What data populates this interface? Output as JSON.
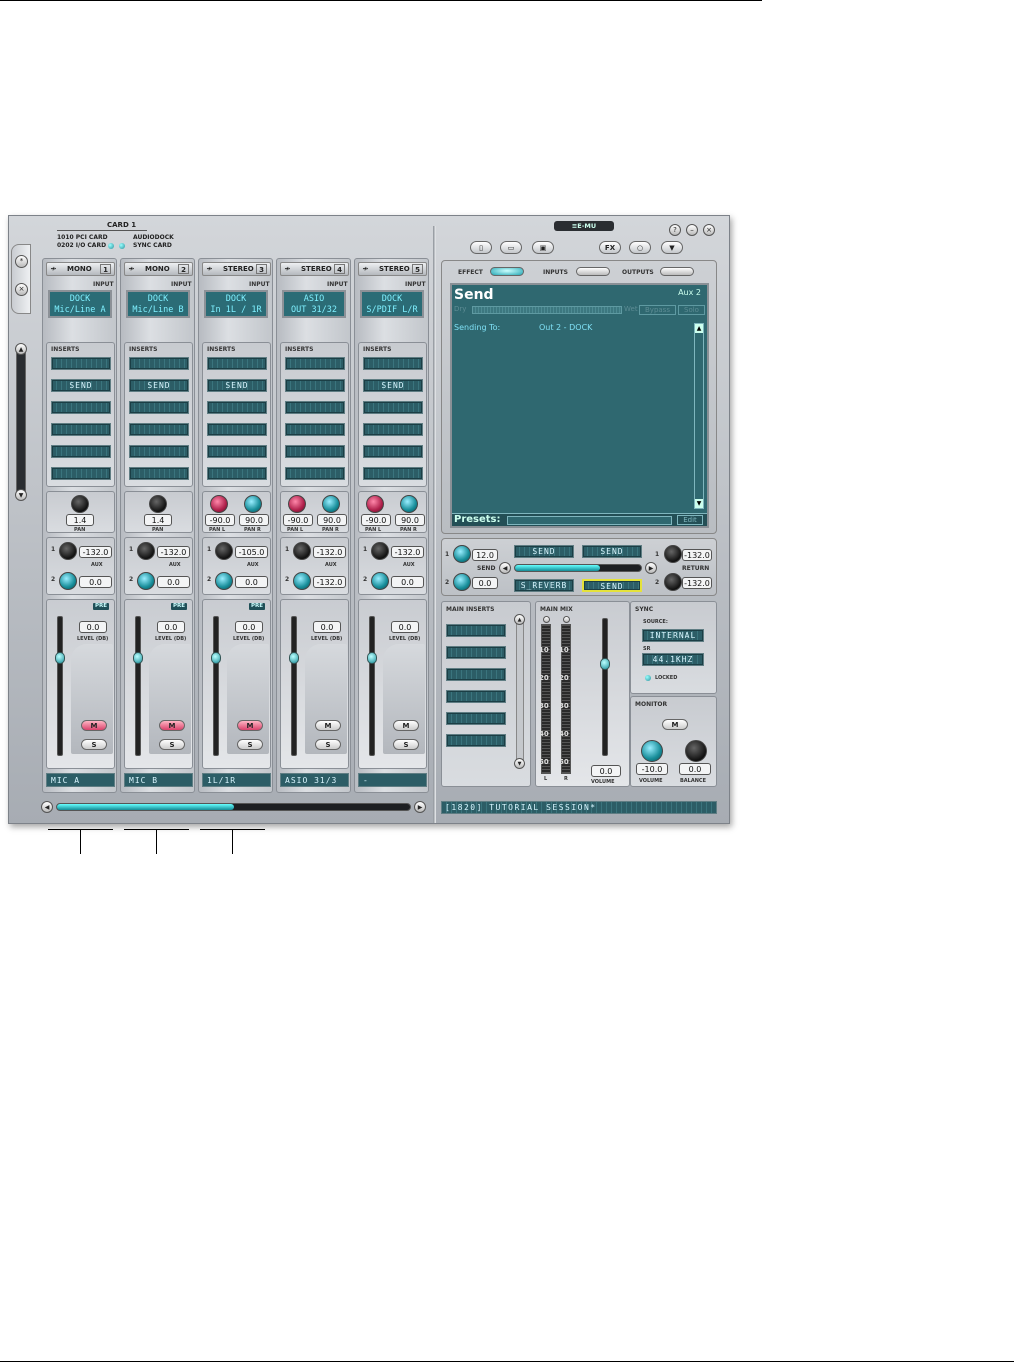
{
  "header": {
    "card_title": "CARD 1",
    "card_1010": "1010 PCI CARD",
    "card_0202": "0202 I/O CARD",
    "audiodock": "AUDIODOCK",
    "sync_card": "SYNC CARD",
    "brand": "≡E-MU"
  },
  "strips": [
    {
      "type": "MONO",
      "num": "1",
      "input1": "DOCK",
      "input2": "Mic/Line A",
      "send": "SEND",
      "pan": [
        "1.4"
      ],
      "pan_labels": [
        "PAN"
      ],
      "aux1": "-132.0",
      "aux2": "0.0",
      "level": "0.0",
      "name": "MIC A",
      "muted": true
    },
    {
      "type": "MONO",
      "num": "2",
      "input1": "DOCK",
      "input2": "Mic/Line B",
      "send": "SEND",
      "pan": [
        "1.4"
      ],
      "pan_labels": [
        "PAN"
      ],
      "aux1": "-132.0",
      "aux2": "0.0",
      "level": "0.0",
      "name": "MIC B",
      "muted": true
    },
    {
      "type": "STEREO",
      "num": "3",
      "input1": "DOCK",
      "input2": "In 1L / 1R",
      "send": "SEND",
      "pan": [
        "-90.0",
        "90.0"
      ],
      "pan_labels": [
        "PAN L",
        "PAN R"
      ],
      "aux1": "-105.0",
      "aux2": "0.0",
      "level": "0.0",
      "name": "1L/1R",
      "muted": true
    },
    {
      "type": "STEREO",
      "num": "4",
      "input1": "ASIO",
      "input2": "OUT 31/32",
      "send": "",
      "pan": [
        "-90.0",
        "90.0"
      ],
      "pan_labels": [
        "PAN L",
        "PAN R"
      ],
      "aux1": "-132.0",
      "aux2": "-132.0",
      "level": "0.0",
      "name": "ASIO 31/3",
      "muted": false
    },
    {
      "type": "STEREO",
      "num": "5",
      "input1": "DOCK",
      "input2": "S/PDIF L/R",
      "send": "SEND",
      "pan": [
        "-90.0",
        "90.0"
      ],
      "pan_labels": [
        "PAN L",
        "PAN R"
      ],
      "aux1": "-132.0",
      "aux2": "0.0",
      "level": "0.0",
      "name": "-",
      "muted": false
    }
  ],
  "labels": {
    "input": "INPUT",
    "inserts": "INSERTS",
    "aux": "AUX",
    "level": "LEVEL (DB)",
    "pre": "PRE",
    "mute": "M",
    "solo": "S"
  },
  "tabs": {
    "effect": "EFFECT",
    "inputs": "INPUTS",
    "outputs": "OUTPUTS"
  },
  "toolbar": {
    "fx": "FX"
  },
  "effect_screen": {
    "title": "Send",
    "aux": "Aux 2",
    "dry": "Dry",
    "wet": "Wet",
    "bypass": "Bypass",
    "solo": "Solo",
    "sending_to_label": "Sending To:",
    "sending_to_value": "Out 2 - DOCK",
    "presets": "Presets:",
    "edit": "Edit"
  },
  "aux_section": {
    "send1": "12.0",
    "send2": "0.0",
    "send_label": "SEND",
    "return_label": "RETURN",
    "return1": "-132.0",
    "return2": "-132.0",
    "slot1": "SEND",
    "slot2": "SEND",
    "slot3": "S_REVERB",
    "slot4": "SEND"
  },
  "main_inserts": {
    "title": "MAIN INSERTS"
  },
  "main_mix": {
    "title": "MAIN MIX",
    "scale": [
      "10",
      "20",
      "30",
      "40",
      "50"
    ],
    "volume": "0.0",
    "volume_label": "VOLUME",
    "l": "L",
    "r": "R"
  },
  "sync": {
    "title": "SYNC",
    "source_label": "SOURCE:",
    "source": "INTERNAL",
    "sr_label": "SR",
    "sr": "44.1KHZ",
    "locked": "LOCKED"
  },
  "monitor": {
    "title": "MONITOR",
    "mute": "M",
    "volume": "-10.0",
    "balance": "0.0",
    "volume_label": "VOLUME",
    "balance_label": "BALANCE"
  },
  "session": {
    "name": "[1820] TUTORIAL SESSION*"
  },
  "scroll": {
    "strips_scroll_position": 0.5
  }
}
